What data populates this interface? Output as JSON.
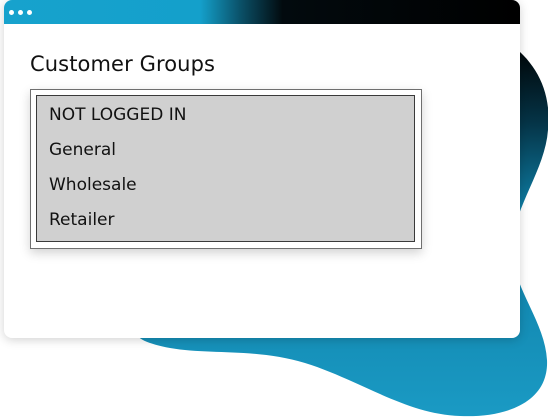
{
  "window": {
    "titlebar_icon": "window-dots-icon"
  },
  "customer_groups": {
    "label": "Customer Groups",
    "options": [
      "NOT LOGGED IN",
      "General",
      "Wholesale",
      "Retailer"
    ]
  },
  "colors": {
    "accent": "#17a2cd",
    "titlebar_dark": "#000000",
    "listbox_bg": "#d0d0d0",
    "blob_top": "#000000",
    "blob_bottom": "#1a9ac4"
  }
}
